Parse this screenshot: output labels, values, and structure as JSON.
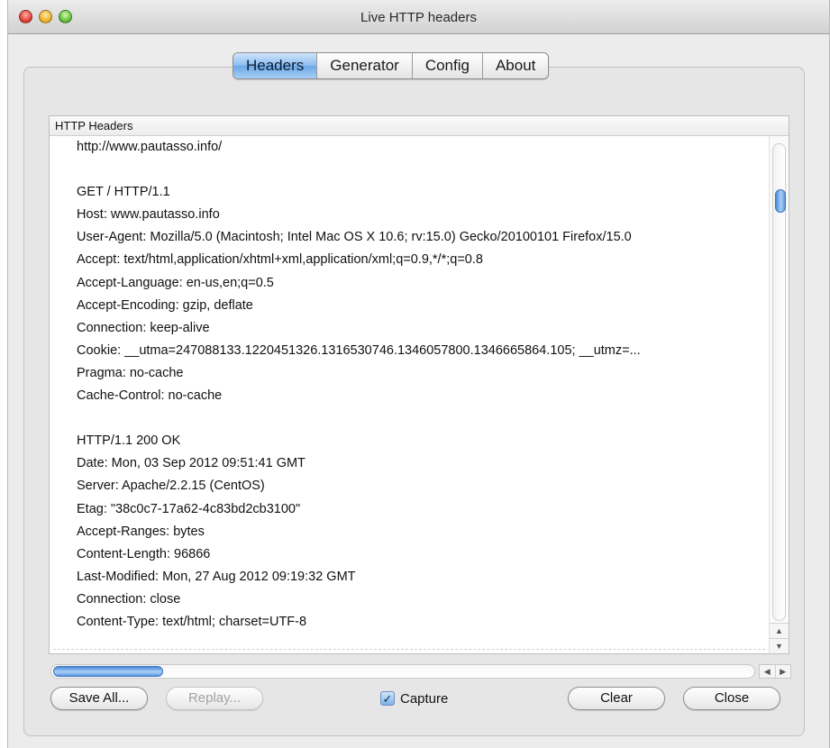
{
  "window": {
    "title": "Live HTTP headers"
  },
  "tabs": [
    {
      "label": "Headers",
      "active": true
    },
    {
      "label": "Generator",
      "active": false
    },
    {
      "label": "Config",
      "active": false
    },
    {
      "label": "About",
      "active": false
    }
  ],
  "panel": {
    "header": "HTTP Headers",
    "lines": [
      "http://www.pautasso.info/",
      "",
      "GET / HTTP/1.1",
      "Host: www.pautasso.info",
      "User-Agent: Mozilla/5.0 (Macintosh; Intel Mac OS X 10.6; rv:15.0) Gecko/20100101 Firefox/15.0",
      "Accept: text/html,application/xhtml+xml,application/xml;q=0.9,*/*;q=0.8",
      "Accept-Language: en-us,en;q=0.5",
      "Accept-Encoding: gzip, deflate",
      "Connection: keep-alive",
      "Cookie: __utma=247088133.1220451326.1316530746.1346057800.1346665864.105; __utmz=...",
      "Pragma: no-cache",
      "Cache-Control: no-cache",
      "",
      "HTTP/1.1 200 OK",
      "Date: Mon, 03 Sep 2012 09:51:41 GMT",
      "Server: Apache/2.2.15 (CentOS)",
      "Etag: \"38c0c7-17a62-4c83bd2cb3100\"",
      "Accept-Ranges: bytes",
      "Content-Length: 96866",
      "Last-Modified: Mon, 27 Aug 2012 09:19:32 GMT",
      "Connection: close",
      "Content-Type: text/html; charset=UTF-8"
    ]
  },
  "buttons": {
    "save_all": "Save All...",
    "replay": "Replay...",
    "clear": "Clear",
    "close": "Close"
  },
  "capture": {
    "label": "Capture",
    "checked": true
  }
}
